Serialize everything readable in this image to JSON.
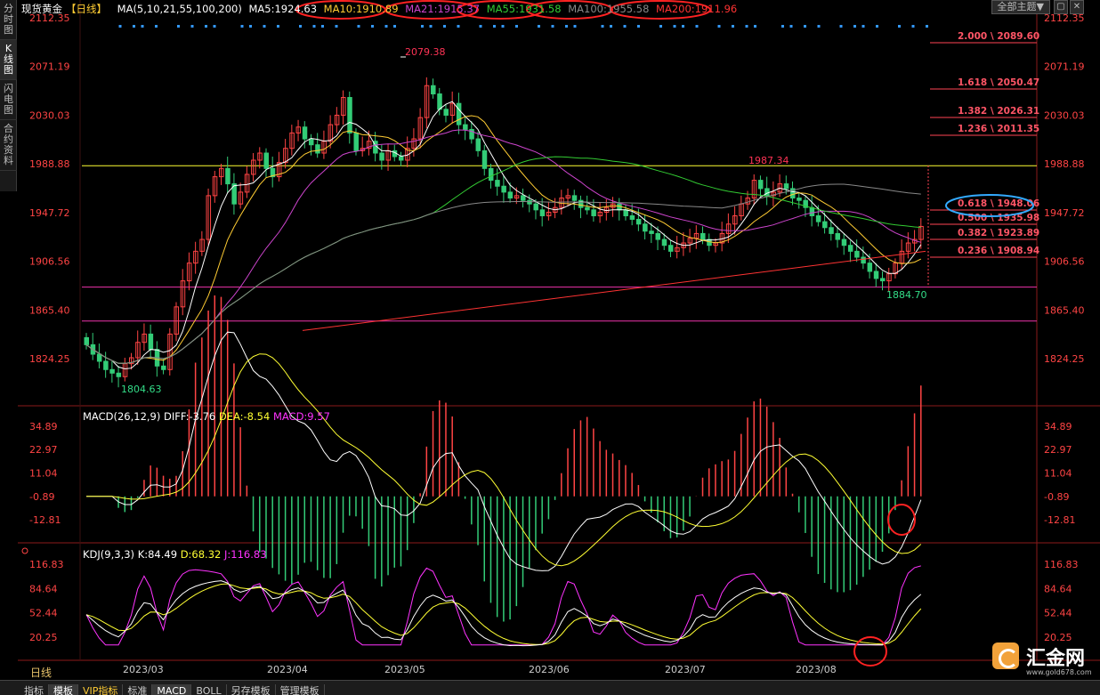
{
  "sidebar": {
    "tabs": [
      {
        "label": "分时图"
      },
      {
        "label": "K线图"
      },
      {
        "label": "闪电图"
      },
      {
        "label": "合约资料"
      }
    ]
  },
  "header": {
    "instrument": "现货黄金",
    "period": "【日线】",
    "ma_params": "MA(5,10,21,55,100,200)",
    "ma_values": [
      {
        "text": "MA5:1924.63",
        "color": "#ffffff"
      },
      {
        "text": "MA10:1910.89",
        "color": "#ffcc33"
      },
      {
        "text": "MA21:1915.37",
        "color": "#cc44cc"
      },
      {
        "text": "MA55:1931.58",
        "color": "#33cc33"
      },
      {
        "text": "MA100:1955.58",
        "color": "#888888"
      },
      {
        "text": "MA200:1911.96",
        "color": "#ff3333"
      }
    ],
    "theme_button": "全部主题▼"
  },
  "price_axis": [
    "2112.35",
    "2071.19",
    "2030.03",
    "1988.88",
    "1947.72",
    "1906.56",
    "1865.40",
    "1824.25"
  ],
  "annotations": {
    "high": "2079.38",
    "low_left": "1804.63",
    "mid_high": "1987.34",
    "low_right": "1884.70"
  },
  "fibonacci": [
    {
      "label": "2.000 \\ 2089.60",
      "price": 2089.6
    },
    {
      "label": "1.618 \\ 2050.47",
      "price": 2050.47
    },
    {
      "label": "1.382 \\ 2026.31",
      "price": 2026.31
    },
    {
      "label": "1.236 \\ 2011.35",
      "price": 2011.35
    },
    {
      "label": "0.618 \\ 1948.06",
      "price": 1948.06
    },
    {
      "label": "0.500 \\ 1935.98",
      "price": 1935.98
    },
    {
      "label": "0.382 \\ 1923.89",
      "price": 1923.89
    },
    {
      "label": "0.236 \\ 1908.94",
      "price": 1908.94
    }
  ],
  "macd": {
    "title": "MACD(26,12,9)",
    "diff": "DIFF:-3.76",
    "dea": "DEA:-8.54",
    "macd": "MACD:9.57",
    "axis": [
      "34.89",
      "22.97",
      "11.04",
      "-0.89",
      "-12.81"
    ]
  },
  "kdj": {
    "title": "KDJ(9,3,3)",
    "k": "K:84.49",
    "d": "D:68.32",
    "j": "J:116.83",
    "axis": [
      "116.83",
      "84.64",
      "52.44",
      "20.25"
    ]
  },
  "xaxis": [
    "2023/03",
    "2023/04",
    "2023/05",
    "2023/06",
    "2023/07",
    "2023/08"
  ],
  "period_label": "日线",
  "bottom_tabs": [
    "指标",
    "模板",
    "VIP指标",
    "标准",
    "MACD",
    "BOLL",
    "另存模板",
    "管理模板"
  ],
  "active_bottom_tab": 1,
  "logo": {
    "name": "汇金网",
    "url": "www.gold678.com"
  },
  "colors": {
    "up": "#33cc77",
    "down": "#ff4444",
    "fib": "#ff4455",
    "yellow": "#ffff33",
    "magenta": "#ff33ff",
    "cyan_circle": "#33aaff",
    "red_circle": "#ff2222"
  },
  "chart_data": {
    "type": "candlestick",
    "closes": [
      1836,
      1828,
      1822,
      1815,
      1812,
      1809,
      1820,
      1825,
      1838,
      1845,
      1832,
      1818,
      1815,
      1845,
      1868,
      1890,
      1905,
      1915,
      1925,
      1962,
      1978,
      1985,
      1972,
      1955,
      1965,
      1980,
      1992,
      1998,
      1985,
      1978,
      1990,
      2002,
      2015,
      2020,
      2010,
      2005,
      1998,
      2008,
      2022,
      2030,
      2045,
      2015,
      2000,
      2002,
      2008,
      1998,
      1992,
      2000,
      1995,
      1992,
      2002,
      2010,
      2028,
      2055,
      2048,
      2035,
      2030,
      2040,
      2022,
      2018,
      2010,
      2000,
      1985,
      1975,
      1970,
      1965,
      1960,
      1962,
      1958,
      1955,
      1950,
      1945,
      1948,
      1952,
      1960,
      1962,
      1958,
      1952,
      1950,
      1945,
      1948,
      1952,
      1955,
      1950,
      1945,
      1942,
      1938,
      1932,
      1930,
      1925,
      1920,
      1915,
      1918,
      1922,
      1926,
      1930,
      1925,
      1920,
      1922,
      1930,
      1938,
      1945,
      1955,
      1960,
      1975,
      1968,
      1962,
      1965,
      1972,
      1968,
      1960,
      1958,
      1952,
      1945,
      1940,
      1935,
      1930,
      1925,
      1920,
      1915,
      1910,
      1905,
      1898,
      1892,
      1890,
      1896,
      1905,
      1915,
      1922,
      1925,
      1936
    ]
  }
}
